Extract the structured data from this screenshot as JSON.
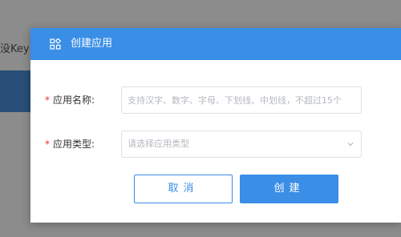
{
  "background": {
    "partial_text": "没Key"
  },
  "dialog": {
    "title": "创建应用",
    "header_icon": "apps-grid-icon",
    "fields": {
      "app_name": {
        "required_mark": "*",
        "label": "应用名称:",
        "placeholder": "支持汉字、数字、字母、下划线、中划线，不超过15个",
        "value": ""
      },
      "app_type": {
        "required_mark": "*",
        "label": "应用类型:",
        "placeholder": "请选择应用类型",
        "icon": "chevron-down-icon"
      }
    },
    "buttons": {
      "cancel": "取消",
      "create": "创建"
    }
  },
  "colors": {
    "primary": "#3a8ee6",
    "required": "#e33333",
    "overlay": "rgba(0,0,0,0.45)"
  }
}
